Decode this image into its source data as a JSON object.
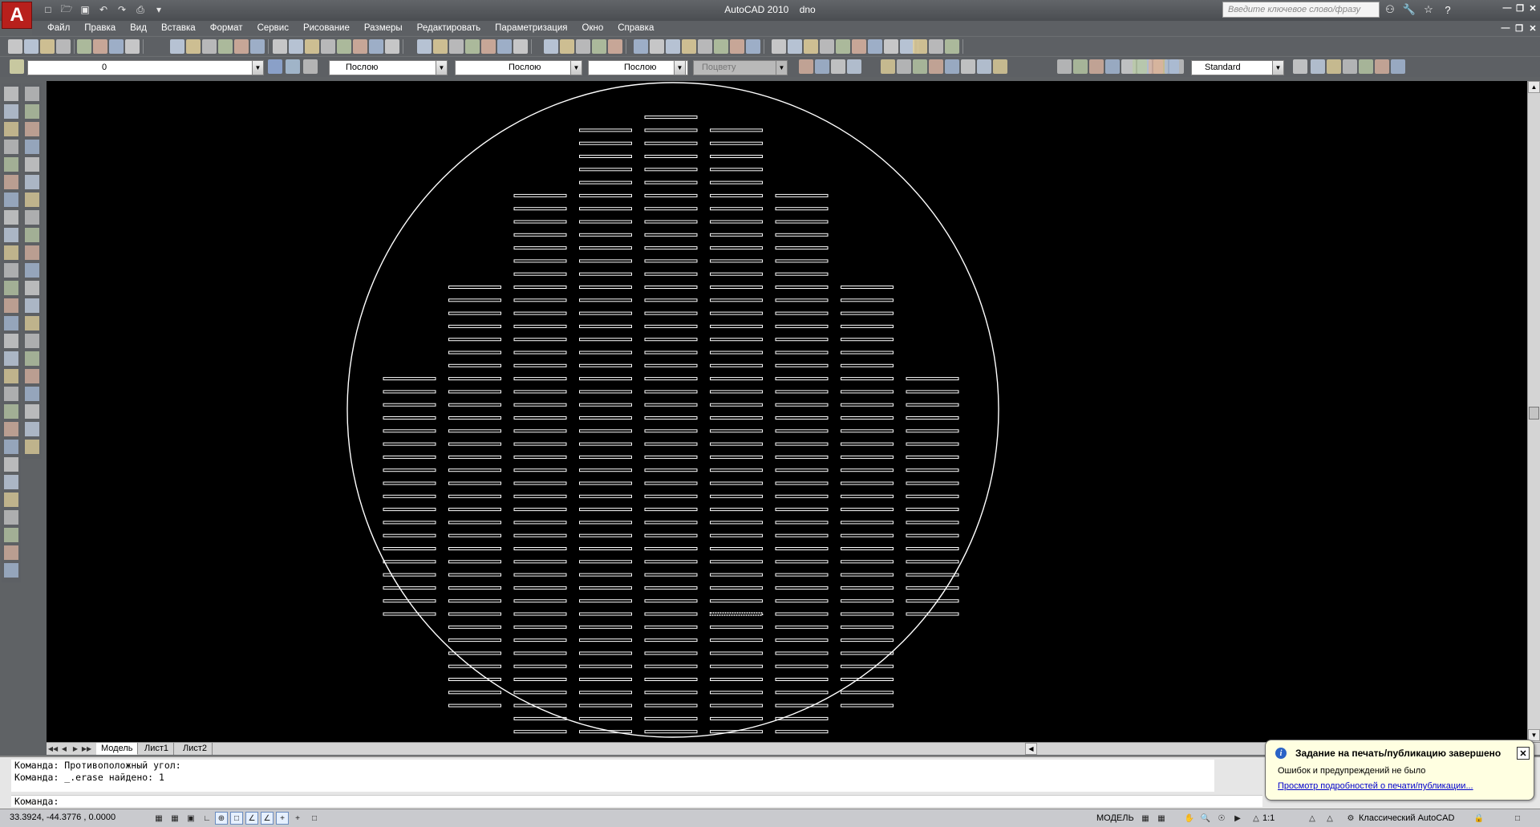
{
  "app": {
    "logo_letter": "A",
    "title": "AutoCAD 2010",
    "document": "dno"
  },
  "quick_access": [
    "new-icon",
    "open-icon",
    "save-icon",
    "undo-icon",
    "redo-icon",
    "plot-icon"
  ],
  "infocenter": {
    "search_placeholder": "Введите ключевое слово/фразу",
    "buttons": [
      "binoculars-icon",
      "communication-center-icon",
      "favorites-icon",
      "help-icon"
    ]
  },
  "menu": [
    "Файл",
    "Правка",
    "Вид",
    "Вставка",
    "Формат",
    "Сервис",
    "Рисование",
    "Размеры",
    "Редактировать",
    "Параметризация",
    "Окно",
    "Справка"
  ],
  "layers_toolbar": {
    "current_layer": "0",
    "color": "Послою",
    "linetype": "Послою",
    "lineweight": "Послою",
    "plotstyle": "Поцвету",
    "dim_style": "Standard"
  },
  "layout_tabs": [
    "Модель",
    "Лист1",
    "Лист2"
  ],
  "active_tab": "Модель",
  "command": {
    "history": [
      "Команда: Противоположный угол:",
      "Команда: _.erase найдено: 1"
    ],
    "prompt": "Команда:"
  },
  "status": {
    "coordinates": "33.3924, -44.3776 , 0.0000",
    "space": "МОДЕЛЬ",
    "annotation_scale": "1:1",
    "workspace": "Классический AutoCAD"
  },
  "notification": {
    "title": "Задание на печать/публикацию завершено",
    "message": "Ошибок и предупреждений не было",
    "link": "Просмотр подробностей о печати/публикации..."
  },
  "drawing": {
    "description_entities": "circle with rows of slot rectangles",
    "colors": {
      "background": "#000000",
      "lines": "#ffffff",
      "selected": "#ffffff"
    },
    "columns": [
      {
        "rows_start": 22,
        "rows_end": 40
      },
      {
        "rows_start": 15,
        "rows_end": 47
      },
      {
        "rows_start": 8,
        "rows_end": 51
      },
      {
        "rows_start": 3,
        "rows_end": 53
      },
      {
        "rows_start": 2,
        "rows_end": 54
      },
      {
        "rows_start": 3,
        "rows_end": 53
      },
      {
        "rows_start": 8,
        "rows_end": 51
      },
      {
        "rows_start": 15,
        "rows_end": 47
      },
      {
        "rows_start": 22,
        "rows_end": 40
      }
    ],
    "selected_slot": {
      "column": 5,
      "row": 40
    }
  }
}
